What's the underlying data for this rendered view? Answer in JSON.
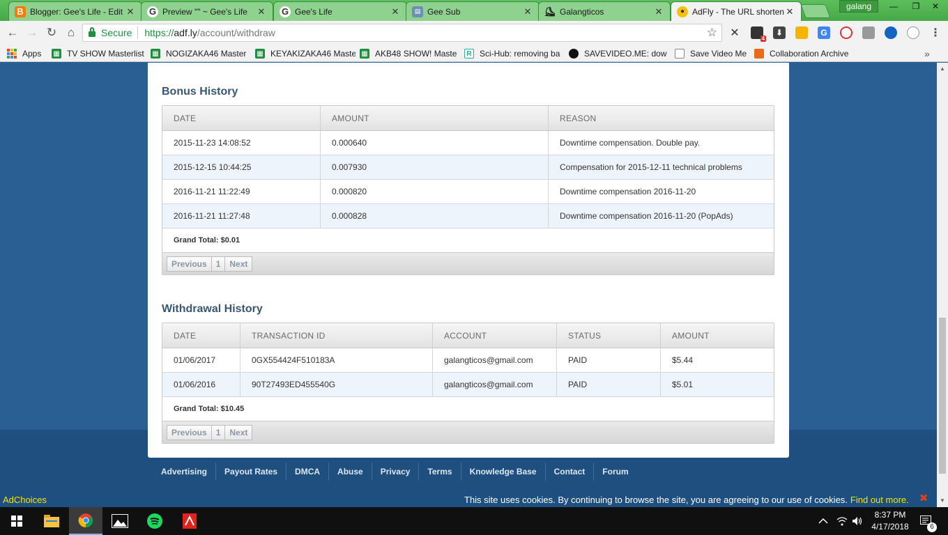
{
  "browser": {
    "tabs": [
      {
        "label": "Blogger: Gee's Life - Edit",
        "icon": "blogger-icon"
      },
      {
        "label": "Preview \"\" ~ Gee's Life",
        "icon": "google-icon"
      },
      {
        "label": "Gee's Life",
        "icon": "google-icon"
      },
      {
        "label": "Gee Sub",
        "icon": "page-icon"
      },
      {
        "label": "Galangticos",
        "icon": "skater-icon"
      },
      {
        "label": "AdFly - The URL shortener",
        "icon": "bee-icon"
      }
    ],
    "profile_name": "galang",
    "secure_label": "Secure",
    "url_scheme": "https://",
    "url_host": "adf.ly",
    "url_path": "/account/withdraw",
    "extension_badge": "4",
    "bookmarks": [
      {
        "label": "Apps"
      },
      {
        "label": "TV SHOW Masterlist"
      },
      {
        "label": "NOGIZAKA46 Master"
      },
      {
        "label": "KEYAKIZAKA46 Maste"
      },
      {
        "label": "AKB48 SHOW! Maste"
      },
      {
        "label": "Sci-Hub: removing ba"
      },
      {
        "label": "SAVEVIDEO.ME: dow"
      },
      {
        "label": "Save Video Me"
      },
      {
        "label": "Collaboration Archive"
      }
    ]
  },
  "bonus": {
    "title": "Bonus History",
    "headers": [
      "DATE",
      "AMOUNT",
      "REASON"
    ],
    "rows": [
      [
        "2015-11-23 14:08:52",
        "0.000640",
        "Downtime compensation. Double pay."
      ],
      [
        "2015-12-15 10:44:25",
        "0.007930",
        "Compensation for 2015-12-11 technical problems"
      ],
      [
        "2016-11-21 11:22:49",
        "0.000820",
        "Downtime compensation 2016-11-20"
      ],
      [
        "2016-11-21 11:27:48",
        "0.000828",
        "Downtime compensation 2016-11-20 (PopAds)"
      ]
    ],
    "grand_total": "Grand Total: $0.01",
    "pager": {
      "prev": "Previous",
      "page": "1",
      "next": "Next"
    }
  },
  "withdrawal": {
    "title": "Withdrawal History",
    "headers": [
      "DATE",
      "TRANSACTION ID",
      "ACCOUNT",
      "STATUS",
      "AMOUNT"
    ],
    "rows": [
      [
        "01/06/2017",
        "0GX554424F510183A",
        "galangticos@gmail.com",
        "PAID",
        "$5.44"
      ],
      [
        "01/06/2016",
        "90T27493ED455540G",
        "galangticos@gmail.com",
        "PAID",
        "$5.01"
      ]
    ],
    "grand_total": "Grand Total: $10.45",
    "pager": {
      "prev": "Previous",
      "page": "1",
      "next": "Next"
    }
  },
  "footer": {
    "links": [
      "Advertising",
      "Payout Rates",
      "DMCA",
      "Abuse",
      "Privacy",
      "Terms",
      "Knowledge Base",
      "Contact",
      "Forum"
    ]
  },
  "cookie": {
    "adchoices": "AdChoices",
    "text": "This site uses cookies. By continuing to browse the site, you are agreeing to our use of cookies.",
    "link": "Find out more."
  },
  "taskbar": {
    "time": "8:37 PM",
    "date": "4/17/2018",
    "notification_count": "6"
  },
  "colors": {
    "page_bg": "#2a5f94",
    "chrome_tabstrip": "#4caf50",
    "section_title": "#3a5670",
    "cookie_link": "#f4e400"
  }
}
